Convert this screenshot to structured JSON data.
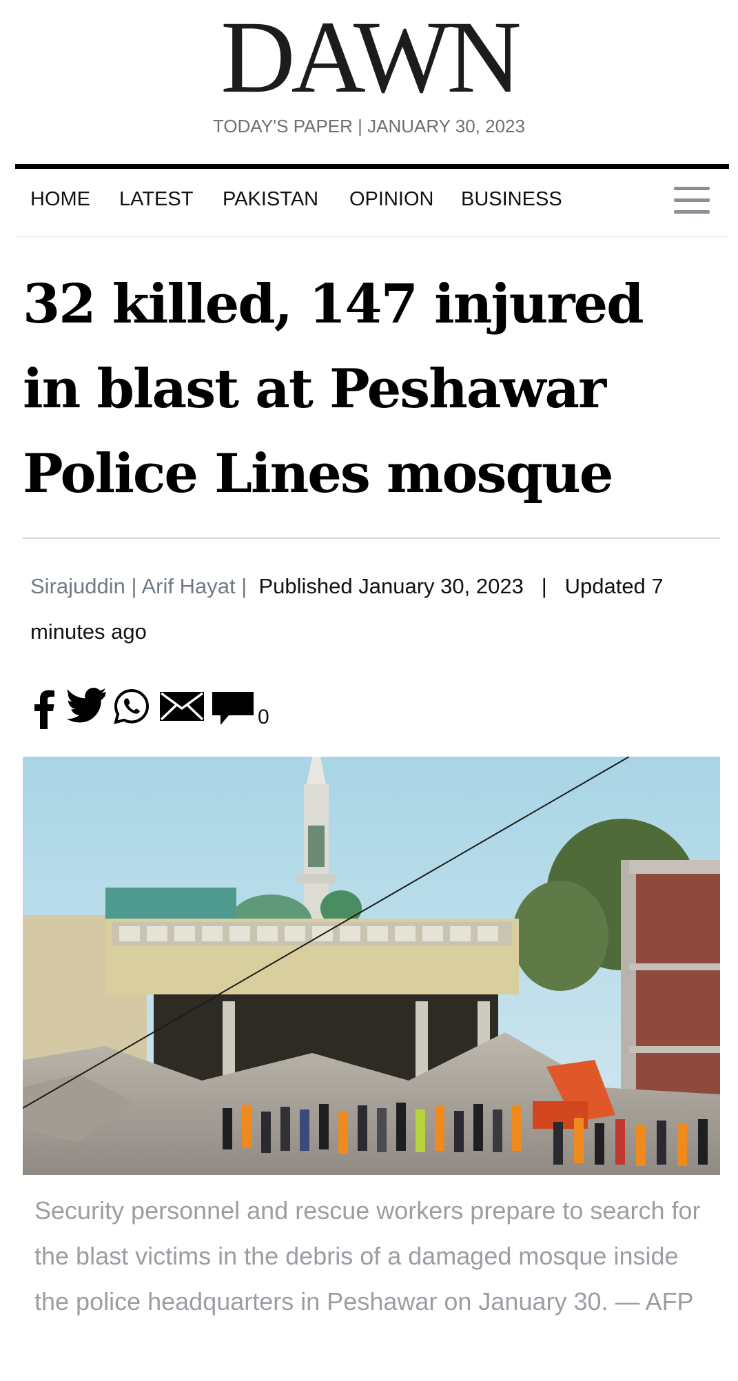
{
  "masthead": {
    "logo": "DAWN",
    "paper_date": "TODAY'S PAPER | JANUARY 30, 2023"
  },
  "nav": {
    "items": [
      "HOME",
      "LATEST",
      "PAKISTAN",
      "OPINION",
      "BUSINESS"
    ],
    "menu_icon": "hamburger-menu-icon"
  },
  "article": {
    "headline": "32 killed, 147 injured in blast at Peshawar Police Lines mosque",
    "authors": [
      "Sirajuddin",
      "Arif Hayat"
    ],
    "author_separator": "|",
    "published": "Published January 30, 2023",
    "updated": "Updated 7 minutes ago",
    "meta_separator": "|"
  },
  "share": {
    "icons": [
      "facebook-icon",
      "twitter-icon",
      "whatsapp-icon",
      "email-icon",
      "comment-icon"
    ],
    "comment_count": "0"
  },
  "image": {
    "caption": "Security personnel and rescue workers prepare to search for the blast victims in the debris of a damaged mosque inside the police headquarters in Peshawar on January 30. — AFP"
  },
  "colors": {
    "nav_rule": "#000000",
    "byline_author": "#707a86",
    "caption": "#9a9ea3",
    "menu_icon": "#8a8f96"
  }
}
